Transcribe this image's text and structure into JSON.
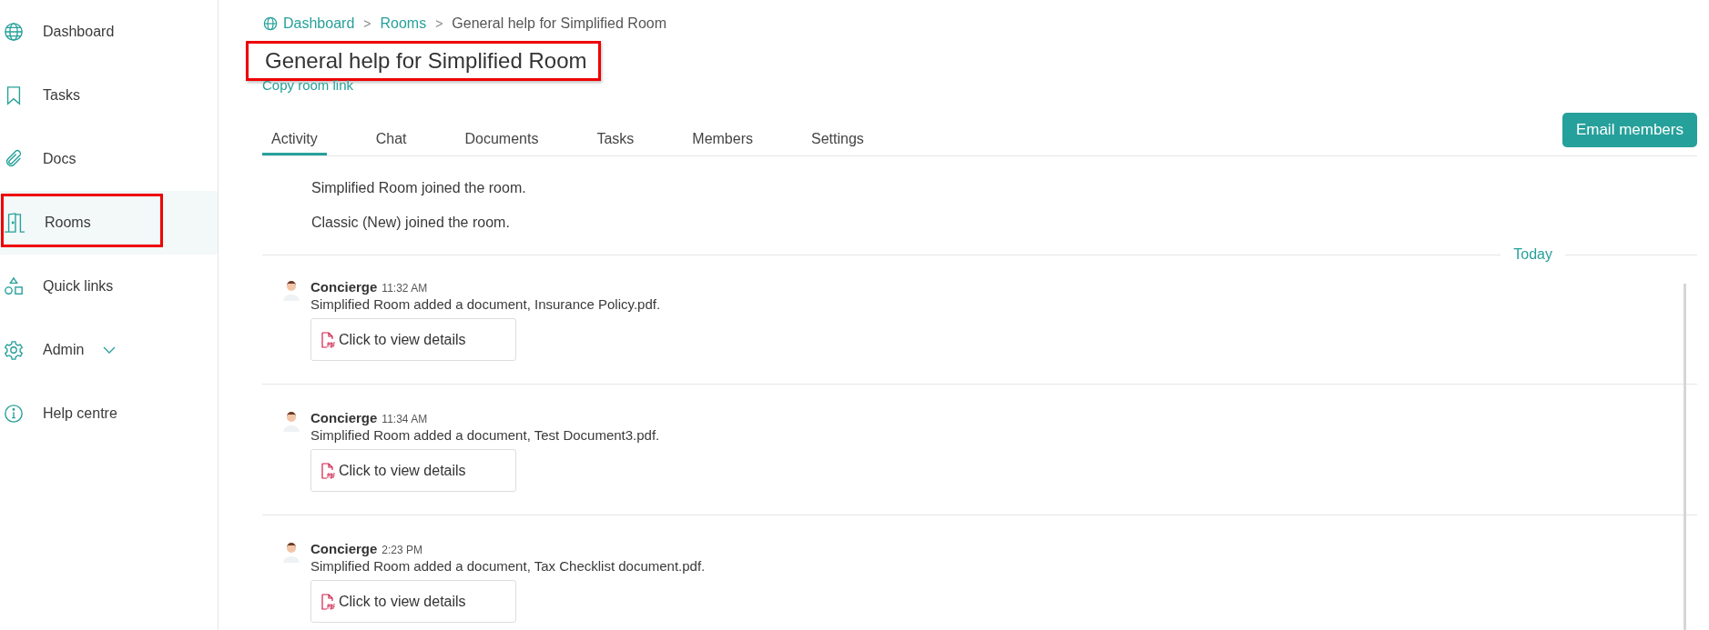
{
  "sidebar": {
    "items": [
      {
        "kind": "globe",
        "label": "Dashboard",
        "selected": false,
        "highlighted": false,
        "expandable": false
      },
      {
        "kind": "bookmark",
        "label": "Tasks",
        "selected": false,
        "highlighted": false,
        "expandable": false
      },
      {
        "kind": "paperclip",
        "label": "Docs",
        "selected": false,
        "highlighted": false,
        "expandable": false
      },
      {
        "kind": "door",
        "label": "Rooms",
        "selected": true,
        "highlighted": true,
        "expandable": false
      },
      {
        "kind": "shapes",
        "label": "Quick links",
        "selected": false,
        "highlighted": false,
        "expandable": false
      },
      {
        "kind": "gear",
        "label": "Admin",
        "selected": false,
        "highlighted": false,
        "expandable": true
      },
      {
        "kind": "info",
        "label": "Help centre",
        "selected": false,
        "highlighted": false,
        "expandable": false
      }
    ]
  },
  "breadcrumb": [
    {
      "kind": "link",
      "label": "Dashboard"
    },
    {
      "kind": "separator",
      "label": ">"
    },
    {
      "kind": "link",
      "label": "Rooms"
    },
    {
      "kind": "separator",
      "label": ">"
    },
    {
      "kind": "current",
      "label": "General help for Simplified Room"
    }
  ],
  "title": {
    "text": "General help for Simplified Room",
    "highlighted": true
  },
  "copy_link": "Copy room link",
  "tabs": [
    {
      "label": "Activity",
      "selected": true
    },
    {
      "label": "Chat",
      "selected": false
    },
    {
      "label": "Documents",
      "selected": false
    },
    {
      "label": "Tasks",
      "selected": false
    },
    {
      "label": "Members",
      "selected": false
    },
    {
      "label": "Settings",
      "selected": false
    }
  ],
  "email_button": "Email members",
  "events": [
    "Simplified Room joined the room.",
    "Classic (New) joined the room."
  ],
  "day_divider": "Today",
  "entries": [
    {
      "author": "Concierge",
      "time": "11:32 AM",
      "text": "Simplified Room added a document, Insurance Policy.pdf.",
      "card": "Click to view details"
    },
    {
      "author": "Concierge",
      "time": "11:34 AM",
      "text": "Simplified Room added a document, Test Document3.pdf.",
      "card": "Click to view details"
    },
    {
      "author": "Concierge",
      "time": "2:23 PM",
      "text": "Simplified Room added a document, Tax Checklist document.pdf.",
      "card": "Click to view details"
    }
  ]
}
